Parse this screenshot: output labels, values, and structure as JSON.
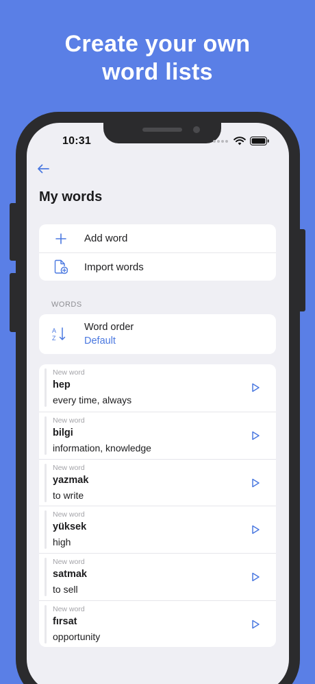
{
  "headline": {
    "line1": "Create your own",
    "line2": "word lists"
  },
  "status_bar": {
    "time": "10:31"
  },
  "nav": {
    "back_icon": "arrow-left-icon"
  },
  "page": {
    "title": "My words"
  },
  "actions": {
    "add_label": "Add word",
    "import_label": "Import words"
  },
  "section": {
    "label": "WORDS"
  },
  "order": {
    "title": "Word order",
    "value": "Default"
  },
  "words": [
    {
      "status": "New word",
      "term": "hep",
      "translation": "every time, always"
    },
    {
      "status": "New word",
      "term": "bilgi",
      "translation": "information, knowledge"
    },
    {
      "status": "New word",
      "term": "yazmak",
      "translation": "to write"
    },
    {
      "status": "New word",
      "term": "yüksek",
      "translation": "high"
    },
    {
      "status": "New word",
      "term": "satmak",
      "translation": "to sell"
    },
    {
      "status": "New word",
      "term": "fırsat",
      "translation": "opportunity"
    }
  ],
  "colors": {
    "background": "#5a7fe6",
    "accent": "#4a78e0",
    "screen": "#efeff4"
  }
}
